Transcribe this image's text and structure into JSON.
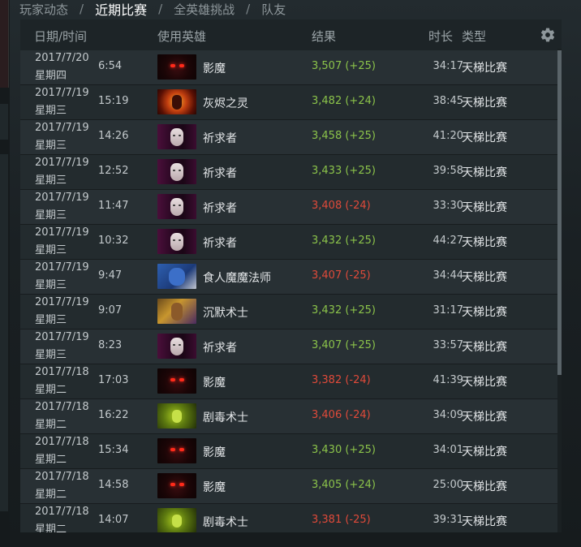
{
  "tabs": [
    {
      "label": "玩家动态",
      "active": false
    },
    {
      "label": "近期比赛",
      "active": true
    },
    {
      "label": "全英雄挑战",
      "active": false
    },
    {
      "label": "队友",
      "active": false
    }
  ],
  "tab_separator": "/",
  "table": {
    "headers": {
      "date_time": "日期/时间",
      "hero": "使用英雄",
      "result": "结果",
      "duration": "时长",
      "type": "类型"
    },
    "settings_icon": "gear-icon",
    "colors": {
      "win": "#8bc34a",
      "loss": "#e04a3a"
    },
    "rows": [
      {
        "date": "2017/7/20",
        "weekday": "星期四",
        "time": "6:54",
        "hero_icon": "shadow-fiend-portrait",
        "hero": "影魔",
        "result": "3,507 (+25)",
        "outcome": "win",
        "duration": "34:17",
        "type": "天梯比赛"
      },
      {
        "date": "2017/7/19",
        "weekday": "星期三",
        "time": "15:19",
        "hero_icon": "ember-spirit-portrait",
        "hero": "灰烬之灵",
        "result": "3,482 (+24)",
        "outcome": "win",
        "duration": "38:45",
        "type": "天梯比赛"
      },
      {
        "date": "2017/7/19",
        "weekday": "星期三",
        "time": "14:26",
        "hero_icon": "invoker-portrait",
        "hero": "祈求者",
        "result": "3,458 (+25)",
        "outcome": "win",
        "duration": "41:20",
        "type": "天梯比赛"
      },
      {
        "date": "2017/7/19",
        "weekday": "星期三",
        "time": "12:52",
        "hero_icon": "invoker-portrait",
        "hero": "祈求者",
        "result": "3,433 (+25)",
        "outcome": "win",
        "duration": "39:58",
        "type": "天梯比赛"
      },
      {
        "date": "2017/7/19",
        "weekday": "星期三",
        "time": "11:47",
        "hero_icon": "invoker-portrait",
        "hero": "祈求者",
        "result": "3,408 (-24)",
        "outcome": "loss",
        "duration": "33:30",
        "type": "天梯比赛"
      },
      {
        "date": "2017/7/19",
        "weekday": "星期三",
        "time": "10:32",
        "hero_icon": "invoker-portrait",
        "hero": "祈求者",
        "result": "3,432 (+25)",
        "outcome": "win",
        "duration": "44:27",
        "type": "天梯比赛"
      },
      {
        "date": "2017/7/19",
        "weekday": "星期三",
        "time": "9:47",
        "hero_icon": "ogre-magi-portrait",
        "hero": "食人魔魔法师",
        "result": "3,407 (-25)",
        "outcome": "loss",
        "duration": "34:44",
        "type": "天梯比赛"
      },
      {
        "date": "2017/7/19",
        "weekday": "星期三",
        "time": "9:07",
        "hero_icon": "silencer-portrait",
        "hero": "沉默术士",
        "result": "3,432 (+25)",
        "outcome": "win",
        "duration": "31:17",
        "type": "天梯比赛"
      },
      {
        "date": "2017/7/19",
        "weekday": "星期三",
        "time": "8:23",
        "hero_icon": "invoker-portrait",
        "hero": "祈求者",
        "result": "3,407 (+25)",
        "outcome": "win",
        "duration": "33:57",
        "type": "天梯比赛"
      },
      {
        "date": "2017/7/18",
        "weekday": "星期二",
        "time": "17:03",
        "hero_icon": "shadow-fiend-portrait",
        "hero": "影魔",
        "result": "3,382 (-24)",
        "outcome": "loss",
        "duration": "41:39",
        "type": "天梯比赛"
      },
      {
        "date": "2017/7/18",
        "weekday": "星期二",
        "time": "16:22",
        "hero_icon": "venomancer-portrait",
        "hero": "剧毒术士",
        "result": "3,406 (-24)",
        "outcome": "loss",
        "duration": "34:09",
        "type": "天梯比赛"
      },
      {
        "date": "2017/7/18",
        "weekday": "星期二",
        "time": "15:34",
        "hero_icon": "shadow-fiend-portrait",
        "hero": "影魔",
        "result": "3,430 (+25)",
        "outcome": "win",
        "duration": "34:01",
        "type": "天梯比赛"
      },
      {
        "date": "2017/7/18",
        "weekday": "星期二",
        "time": "14:58",
        "hero_icon": "shadow-fiend-portrait",
        "hero": "影魔",
        "result": "3,405 (+24)",
        "outcome": "win",
        "duration": "25:00",
        "type": "天梯比赛"
      },
      {
        "date": "2017/7/18",
        "weekday": "星期二",
        "time": "14:07",
        "hero_icon": "venomancer-portrait",
        "hero": "剧毒术士",
        "result": "3,381 (-25)",
        "outcome": "loss",
        "duration": "39:31",
        "type": "天梯比赛"
      }
    ]
  }
}
